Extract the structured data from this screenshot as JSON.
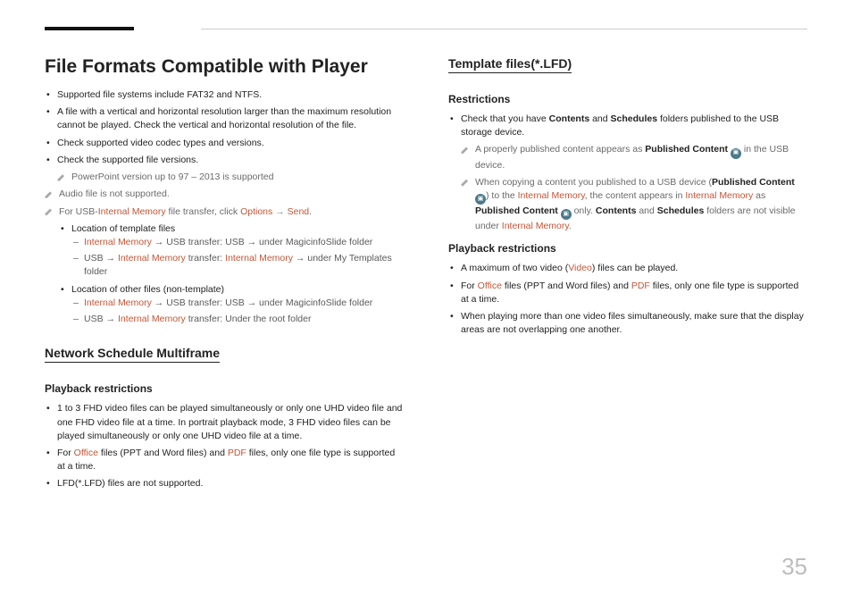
{
  "page_number": "35",
  "left": {
    "h1": "File Formats Compatible with Player",
    "b1": "Supported file systems include FAT32 and NTFS.",
    "b2": "A file with a vertical and horizontal resolution larger than the maximum resolution cannot be played. Check the vertical and horizontal resolution of the file.",
    "b3": "Check supported video codec types and versions.",
    "b4": "Check the supported file versions.",
    "n1": "PowerPoint version up to 97 – 2013 is supported",
    "n2": "Audio file is not supported.",
    "n3a": "For USB-",
    "n3b": "Internal Memory",
    "n3c": " file transfer, click ",
    "n3d": "Options",
    "n3e": "Send",
    "n3f": ".",
    "sb1": "Location of template files",
    "d1a": "Internal Memory",
    "d1b": " → USB transfer: USB → under MagicinfoSlide folder",
    "d2a": "USB → ",
    "d2b": "Internal Memory",
    "d2c": " transfer: ",
    "d2d": "Internal Memory",
    "d2e": " → under My Templates folder",
    "sb2": "Location of other files (non-template)",
    "d3a": "Internal Memory",
    "d3b": " → USB transfer: USB → under MagicinfoSlide folder",
    "d4a": "USB → ",
    "d4b": "Internal Memory",
    "d4c": " transfer: Under the root folder",
    "h2": "Network Schedule Multiframe",
    "h3": "Playback restrictions",
    "pb1": "1 to 3 FHD video files can be played simultaneously or only one UHD video file and one FHD video file at a time. In portrait playback mode, 3 FHD video files can be played simultaneously or only one UHD video file at a time.",
    "pb2a": "For ",
    "pb2b": "Office",
    "pb2c": " files (PPT and Word files) and ",
    "pb2d": "PDF",
    "pb2e": " files, only one file type is supported at a time.",
    "pb3": "LFD(*.LFD) files are not supported."
  },
  "right": {
    "h2": "Template files(*.LFD)",
    "h3a": "Restrictions",
    "r1a": "Check that you have ",
    "r1b": "Contents",
    "r1c": " and ",
    "r1d": "Schedules",
    "r1e": " folders published to the USB storage device.",
    "rn1a": "A properly published content appears as ",
    "rn1b": "Published Content",
    "rn1c": " in the USB device.",
    "rn2a": "When copying a content you published to a USB device (",
    "rn2b": "Published Content",
    "rn2c": ") to the ",
    "rn2d": "Internal Memory",
    "rn2e": ", the content appears in ",
    "rn2f": "Internal Memory",
    "rn2g": " as ",
    "rn2h": "Published Content",
    "rn2i": " only. ",
    "rn2j": "Contents",
    "rn2k": " and ",
    "rn2l": "Schedules",
    "rn2m": " folders are not visible under ",
    "rn2n": "Internal Memory",
    "rn2o": ".",
    "h3b": "Playback restrictions",
    "p1a": "A maximum of two video (",
    "p1b": "Video",
    "p1c": ") files can be played.",
    "p2a": "For ",
    "p2b": "Office",
    "p2c": " files (PPT and Word files) and ",
    "p2d": "PDF",
    "p2e": " files, only one file type is supported at a time.",
    "p3": "When playing more than one video files simultaneously, make sure that the display areas are not overlapping one another."
  }
}
